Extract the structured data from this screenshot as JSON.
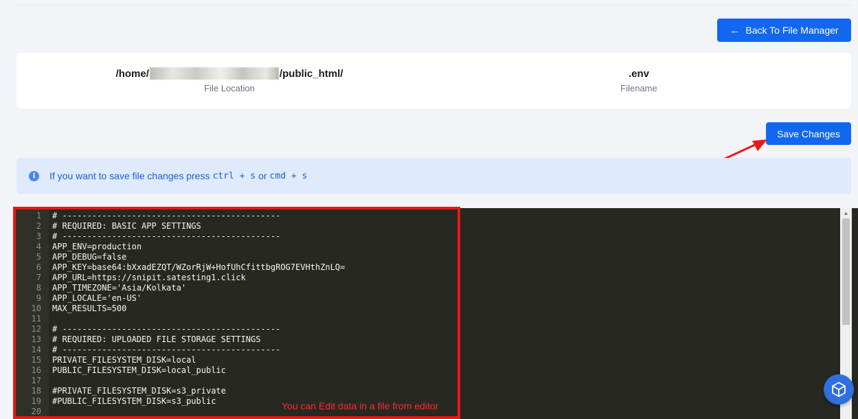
{
  "header": {
    "back_button_label": "Back To File Manager",
    "back_arrow_glyph": "←"
  },
  "file_info": {
    "location_prefix": "/home/",
    "location_suffix": "/public_html/",
    "location_label": "File Location",
    "filename": ".env",
    "filename_label": "Filename"
  },
  "actions": {
    "save_label": "Save Changes"
  },
  "alert": {
    "text_before": "If you want to save file changes press",
    "shortcut_ctrl": "ctrl + s",
    "text_or": "or",
    "shortcut_cmd": "cmd + s",
    "icon": "info-icon"
  },
  "editor": {
    "lines": [
      {
        "n": "1",
        "text": "# --------------------------------------------"
      },
      {
        "n": "2",
        "text": "# REQUIRED: BASIC APP SETTINGS"
      },
      {
        "n": "3",
        "text": "# --------------------------------------------"
      },
      {
        "n": "4",
        "text": "APP_ENV=production"
      },
      {
        "n": "5",
        "text": "APP_DEBUG=false"
      },
      {
        "n": "6",
        "text": "APP_KEY=base64:bXxadEZQT/WZorRjW+HofUhCfittbgROG7EVHthZnLQ="
      },
      {
        "n": "7",
        "text": "APP_URL=https://snipit.satesting1.click"
      },
      {
        "n": "8",
        "text": "APP_TIMEZONE='Asia/Kolkata'"
      },
      {
        "n": "9",
        "text": "APP_LOCALE='en-US'"
      },
      {
        "n": "10",
        "text": "MAX_RESULTS=500"
      },
      {
        "n": "11",
        "text": ""
      },
      {
        "n": "12",
        "text": "# --------------------------------------------"
      },
      {
        "n": "13",
        "text": "# REQUIRED: UPLOADED FILE STORAGE SETTINGS"
      },
      {
        "n": "14",
        "text": "# --------------------------------------------"
      },
      {
        "n": "15",
        "text": "PRIVATE_FILESYSTEM_DISK=local"
      },
      {
        "n": "16",
        "text": "PUBLIC_FILESYSTEM_DISK=local_public"
      },
      {
        "n": "17",
        "text": ""
      },
      {
        "n": "18",
        "text": "#PRIVATE_FILESYSTEM_DISK=s3_private"
      },
      {
        "n": "19",
        "text": "#PUBLIC_FILESYSTEM_DISK=s3_public"
      },
      {
        "n": "20",
        "text": ""
      }
    ]
  },
  "annotation": {
    "text": "You can Edit data in a file from editor",
    "color": "#ff2a2a"
  },
  "colors": {
    "primary": "#1167f0",
    "alert_bg": "#dfeafc",
    "editor_bg": "#272822",
    "highlight_red": "#e81919"
  }
}
